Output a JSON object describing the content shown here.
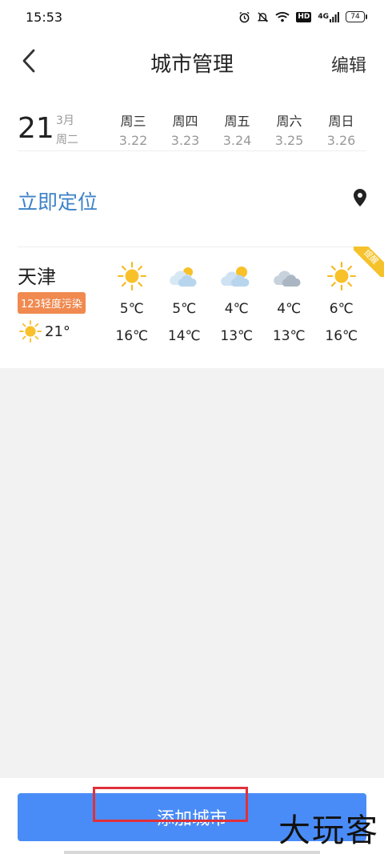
{
  "status_bar": {
    "time": "15:53",
    "icons": [
      "alarm-icon",
      "mute-icon",
      "wifi-icon",
      "hd-icon",
      "signal-4g-icon",
      "battery-icon"
    ],
    "hd_label": "HD",
    "network_label": "4G",
    "battery": "74"
  },
  "header": {
    "back_icon": "chevron-left-icon",
    "title": "城市管理",
    "edit_label": "编辑"
  },
  "date": {
    "day": "21",
    "month": "3月",
    "weekday": "周二",
    "upcoming": [
      {
        "name": "周三",
        "date": "3.22"
      },
      {
        "name": "周四",
        "date": "3.23"
      },
      {
        "name": "周五",
        "date": "3.24"
      },
      {
        "name": "周六",
        "date": "3.25"
      },
      {
        "name": "周日",
        "date": "3.26"
      }
    ]
  },
  "locate": {
    "label": "立即定位",
    "icon": "location-pin-icon"
  },
  "city": {
    "name": "天津",
    "aqi_badge": "123轻度污染",
    "current_icon": "sunny-icon",
    "current_temp": "21°",
    "ribbon_text": "提醒",
    "forecast": [
      {
        "icon": "sunny-icon",
        "low": "5℃",
        "high": "16℃"
      },
      {
        "icon": "cloudy-icon",
        "low": "5℃",
        "high": "14℃"
      },
      {
        "icon": "partly-cloudy-icon",
        "low": "4℃",
        "high": "13℃"
      },
      {
        "icon": "overcast-icon",
        "low": "4℃",
        "high": "13℃"
      },
      {
        "icon": "sunny-icon",
        "low": "6℃",
        "high": "16℃"
      }
    ]
  },
  "footer": {
    "add_city_label": "添加城市",
    "watermark": "大玩客"
  },
  "colors": {
    "accent_blue": "#4a8cf7",
    "locate_blue": "#3d82c7",
    "aqi_orange": "#f08a50",
    "ribbon_yellow": "#f5c22b",
    "highlight_red": "#e0303a"
  }
}
